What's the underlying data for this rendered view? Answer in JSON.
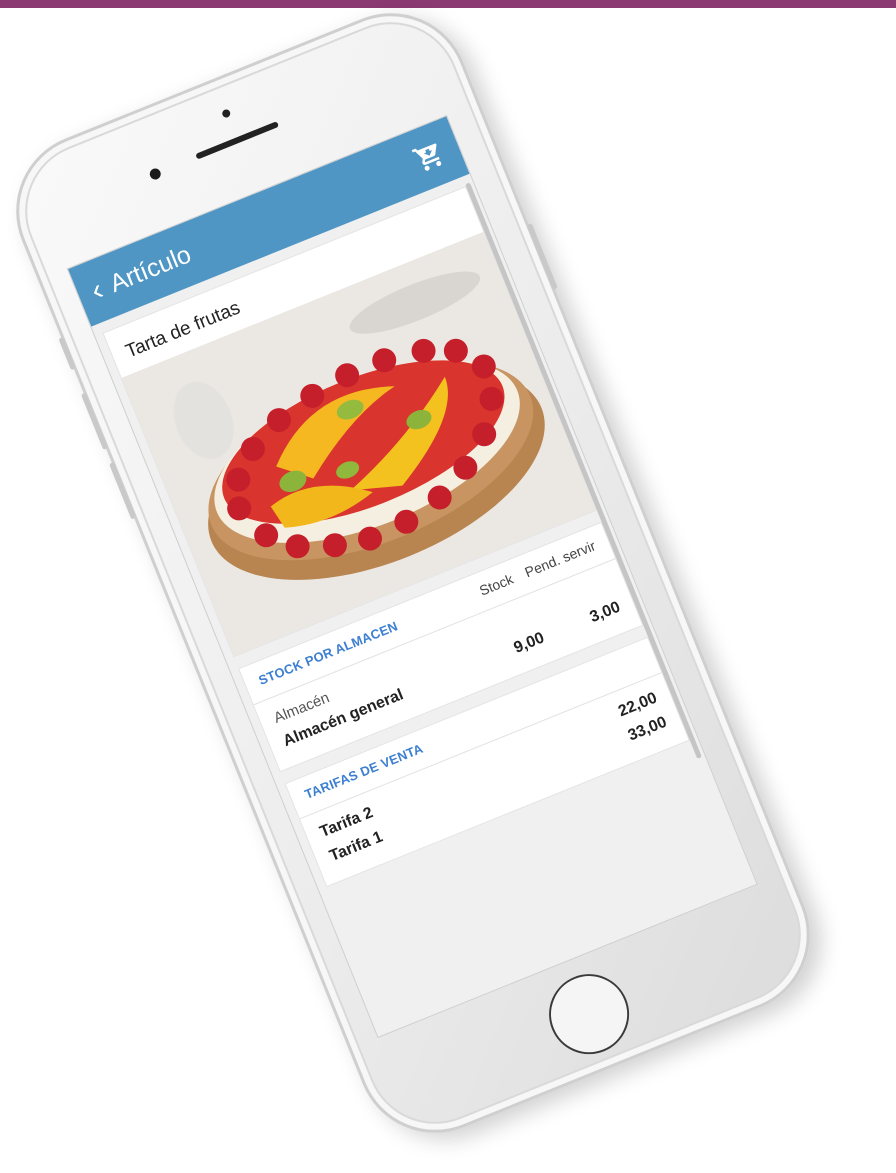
{
  "appbar": {
    "title": "Artículo",
    "back_icon": "chevron-left-icon",
    "cart_icon": "shopping-cart-icon",
    "color": "#4f96c4"
  },
  "product": {
    "name": "Tarta de frutas"
  },
  "stock": {
    "section_title": "STOCK POR ALMACEN",
    "columns": [
      "Stock",
      "Pend. servir"
    ],
    "warehouse_label": "Almacén",
    "rows": [
      {
        "name": "Almacén general",
        "stock": "9,00",
        "pending": "3,00"
      }
    ]
  },
  "tariffs": {
    "section_title": "TARIFAS DE VENTA",
    "rows": [
      {
        "name": "Tarifa 2",
        "price": "22,00"
      },
      {
        "name": "Tarifa 1",
        "price": "33,00"
      }
    ]
  },
  "colors": {
    "top_bar": "#8c3a72",
    "section_title": "#3d7fd1"
  }
}
